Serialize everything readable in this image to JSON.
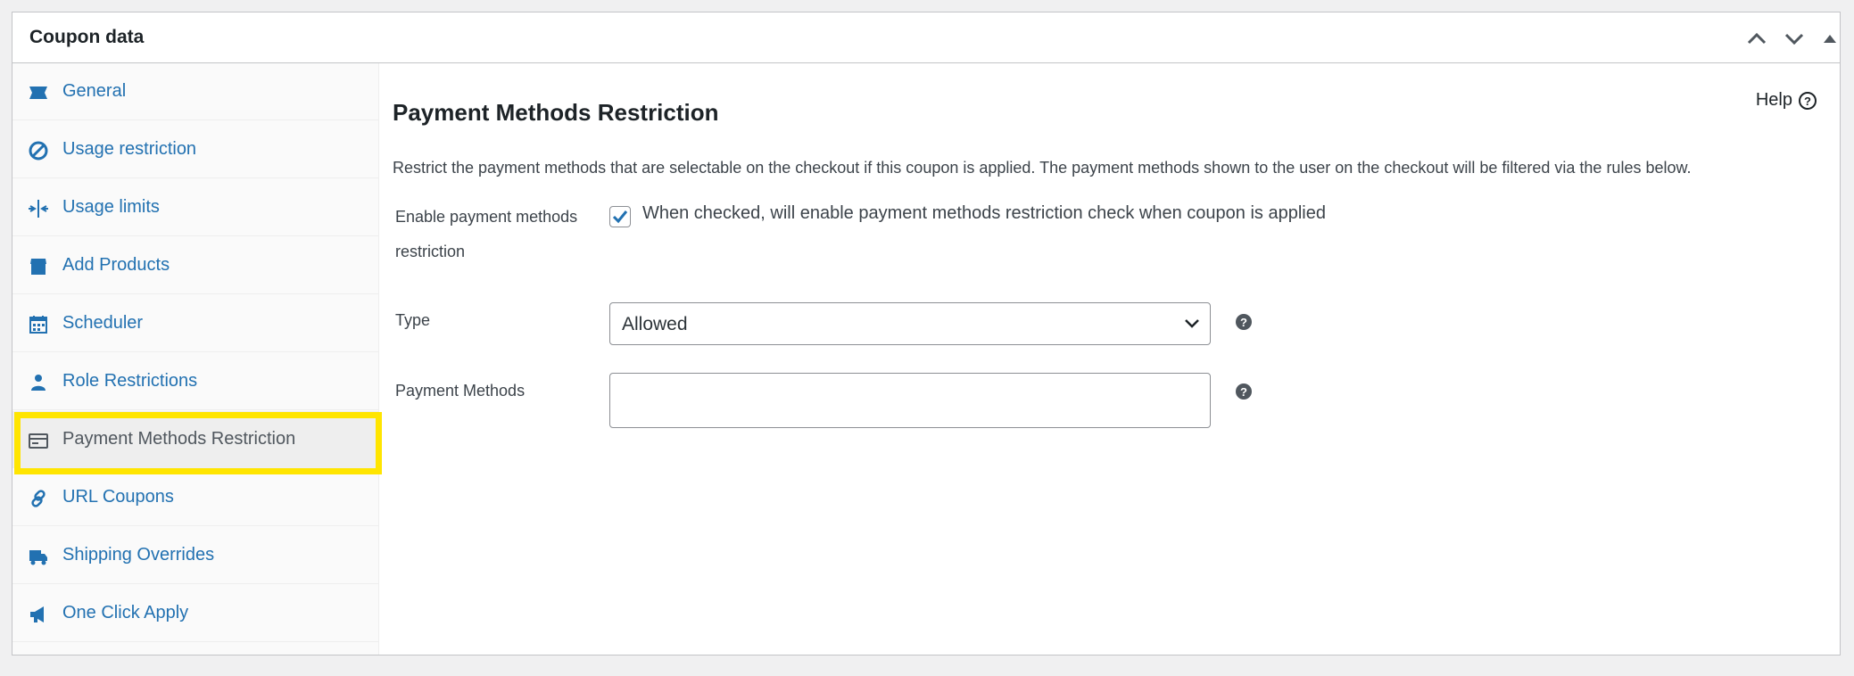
{
  "panel": {
    "title": "Coupon data",
    "controls": [
      "collapse-up-icon",
      "collapse-down-icon",
      "toggle-triangle-icon"
    ]
  },
  "sidebar": {
    "items": [
      {
        "label": "General",
        "icon": "ticket-icon"
      },
      {
        "label": "Usage restriction",
        "icon": "ban-icon"
      },
      {
        "label": "Usage limits",
        "icon": "limits-icon"
      },
      {
        "label": "Add Products",
        "icon": "store-icon"
      },
      {
        "label": "Scheduler",
        "icon": "calendar-icon"
      },
      {
        "label": "Role Restrictions",
        "icon": "person-icon"
      },
      {
        "label": "Payment Methods Restriction",
        "icon": "card-icon",
        "active": true
      },
      {
        "label": "URL Coupons",
        "icon": "link-icon"
      },
      {
        "label": "Shipping Overrides",
        "icon": "truck-icon"
      },
      {
        "label": "One Click Apply",
        "icon": "megaphone-icon"
      }
    ]
  },
  "content": {
    "heading": "Payment Methods Restriction",
    "help_label": "Help",
    "description": "Restrict the payment methods that are selectable on the checkout if this coupon is applied. The payment methods shown to the user on the checkout will be filtered via the rules below.",
    "enable": {
      "label_line1": "Enable payment methods",
      "label_line2": "restriction",
      "checked": true,
      "checkbox_label": "When checked, will enable payment methods restriction check when coupon is applied"
    },
    "type": {
      "label": "Type",
      "selected": "Allowed"
    },
    "payment_methods": {
      "label": "Payment Methods",
      "value": ""
    }
  },
  "colors": {
    "link": "#2271b1",
    "highlight": "#ffe500",
    "checkbox": "#2271b1"
  }
}
